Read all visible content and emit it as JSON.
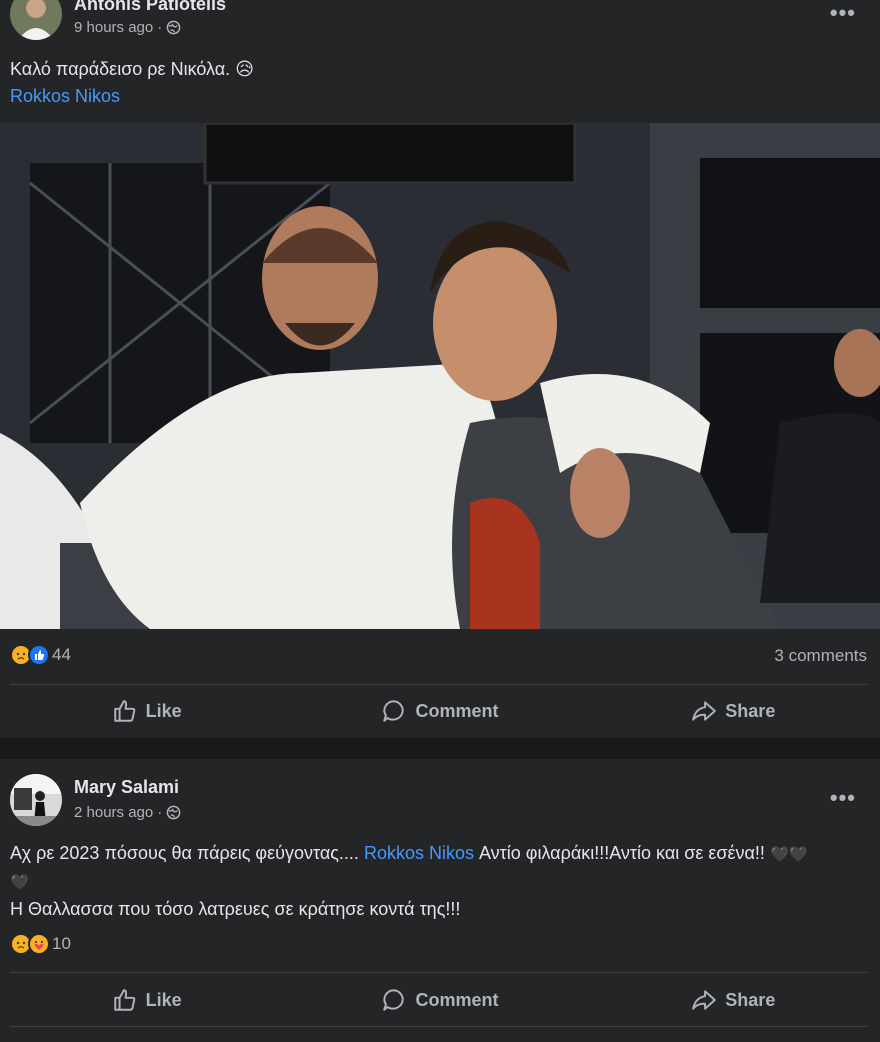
{
  "posts": [
    {
      "author": "Antonis Patlotelis",
      "time": "9 hours ago",
      "separator": "·",
      "privacy_icon": "globe-icon",
      "text": "Καλό παράδεισο ρε Νικόλα.",
      "text_emoji": "😥",
      "mention": "Rokkos Nikos",
      "reaction_icons": [
        "sad-reaction-icon",
        "like-reaction-icon"
      ],
      "reaction_count": "44",
      "comments": "3 comments",
      "actions": {
        "like": "Like",
        "comment": "Comment",
        "share": "Share"
      }
    },
    {
      "author": "Mary Salami",
      "time": "2 hours ago",
      "separator": "·",
      "privacy_icon": "globe-icon",
      "text_before": "Αχ ρε 2023 πόσους θα πάρεις φεύγοντας....",
      "mention": "Rokkos Nikos",
      "text_after": "  Αντίο  φιλαράκι!!!Αντίο  και σε εσένα!!",
      "hearts": "🖤🖤🖤",
      "line2": "Η Θαλλασσα που τόσο λατρευες  σε κράτησε κοντά της!!!",
      "reaction_icons": [
        "sad-reaction-icon",
        "care-reaction-icon"
      ],
      "reaction_count": "10",
      "actions": {
        "like": "Like",
        "comment": "Comment",
        "share": "Share"
      }
    }
  ],
  "colors": {
    "background": "#18191a",
    "card": "#242526",
    "text": "#e4e6eb",
    "secondary": "#b0b3b8",
    "link": "#4599ff"
  }
}
